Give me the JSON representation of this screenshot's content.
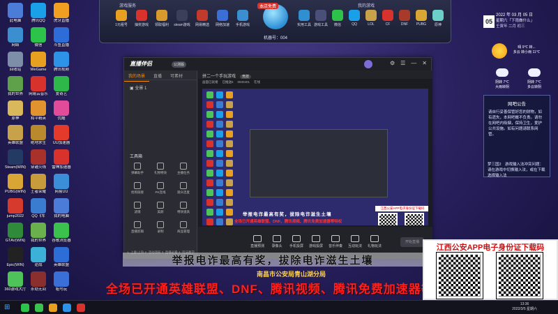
{
  "desktop": {
    "icons": [
      {
        "label": "此电脑",
        "color": "#4a7cd8"
      },
      {
        "label": "网络",
        "color": "#3b8fd0"
      },
      {
        "label": "回收站",
        "color": "#7d8fa8"
      },
      {
        "label": "我的世界",
        "color": "#5fa04a"
      },
      {
        "label": "原神",
        "color": "#d8b85a"
      },
      {
        "label": "英雄联盟",
        "color": "#c8a24a"
      },
      {
        "label": "Steam(WIN)",
        "color": "#233b63"
      },
      {
        "label": "PUBG(WIN)",
        "color": "#d9a534"
      },
      {
        "label": "jump2022",
        "color": "#d63a2c"
      },
      {
        "label": "GTAV(WIN)",
        "color": "#2f8a3a"
      },
      {
        "label": "Epic(WIN)",
        "color": "#222222"
      },
      {
        "label": "360游戏大厅",
        "color": "#4ec35a"
      },
      {
        "label": "腾讯QQ",
        "color": "#1aa0e8"
      },
      {
        "label": "微信",
        "color": "#2dc34a"
      },
      {
        "label": "WeGame",
        "color": "#e8a021"
      },
      {
        "label": "网易云音乐",
        "color": "#d8322c"
      },
      {
        "label": "和平精英",
        "color": "#e0932e"
      },
      {
        "label": "绝地求生",
        "color": "#b9892e"
      },
      {
        "label": "穿越火线",
        "color": "#a8312b"
      },
      {
        "label": "王者荣耀",
        "color": "#c79a3b"
      },
      {
        "label": "QQ飞车",
        "color": "#3a7dd0"
      },
      {
        "label": "我的世界",
        "color": "#6ab04c"
      },
      {
        "label": "逆战",
        "color": "#3bb1d8"
      },
      {
        "label": "永劫无间",
        "color": "#8a2e2e"
      },
      {
        "label": "虎牙直播",
        "color": "#f0a020"
      },
      {
        "label": "斗鱼直播",
        "color": "#2e6dd8"
      },
      {
        "label": "腾讯视频",
        "color": "#2c93e8"
      },
      {
        "label": "爱奇艺",
        "color": "#2fb84a"
      },
      {
        "label": "优酷",
        "color": "#e24b9a"
      },
      {
        "label": "UU加速器",
        "color": "#e43a2c"
      },
      {
        "label": "雷神加速器",
        "color": "#d8322c"
      },
      {
        "label": "网易UU",
        "color": "#3a8fd8"
      },
      {
        "label": "我的电脑",
        "color": "#4a7cd8"
      },
      {
        "label": "谷歌浏览器",
        "color": "#3ac14e"
      },
      {
        "label": "英雄联盟",
        "color": "#2c6dd8"
      },
      {
        "label": "租号玩",
        "color": "#3b6fd8"
      }
    ]
  },
  "topbar": {
    "left_section": "游戏服务",
    "right_section": "我的游戏",
    "center_tag": "本店免费",
    "machine_label": "机器号：004",
    "left_items": [
      "1元租号",
      "抽奖游戏",
      "领取福利",
      "steam游戏",
      "网易精选",
      "网络加速",
      "手机游戏"
    ],
    "right_items": [
      "实用工具",
      "游戏工具",
      "微信",
      "QQ",
      "LOL",
      "CF",
      "DNF",
      "PUBG",
      "原神"
    ]
  },
  "clock": {
    "day": "05",
    "date": "2022 年 03 月 05 日",
    "week": "星期六「下雨做什么」",
    "cal": "壬寅年 二月 初三"
  },
  "weather": {
    "today": "晴 9℃ 转...",
    "today_sub": "多云 转小雨 11℃",
    "tomorrow": "阴转 7℃",
    "tomorrow_sub": "大雨转阴",
    "day_after": "阴转 7℃",
    "day_after_sub": "多云转阴"
  },
  "notice": {
    "title": "网吧公告",
    "body": "请自行妥善保管好您的财物，如有遗失，本网吧概不负责。请勿在网吧内吸烟，保持卫生，爱护公共设施。如有问题请联系网管。",
    "body2": "梦三国2　游戏输入法冲突问题：请在游戏中切换输入法，或在下载选择输入法"
  },
  "app": {
    "title": "直播伴侣",
    "badge": "公测版",
    "tabs": [
      "我的场景",
      "直播",
      "可素材"
    ],
    "scene": "全景 1",
    "toolbox": "工具箱",
    "tools": [
      "弹幕助手",
      "礼物特效",
      "主播任务",
      "抢购链接",
      "PK连线",
      "观众连麦",
      "滤镜",
      "美颜",
      "特效道具",
      "直播剪辑",
      "录制",
      "商品管理"
    ],
    "main_head": "拼二一个手玩游戏",
    "scene_badge": "竞技",
    "status": [
      "画面已就绪",
      "已推送5",
      "0930401",
      "在线"
    ],
    "controls": [
      "直播预测",
      "录像头",
      "手机投屏",
      "游戏投屏",
      "音乐伴奏",
      "互动玩法",
      "礼物玩法"
    ],
    "go_live": "开始直播",
    "tips": "1. 上麦/上热   2. 活动须知   3. 直播必看   4. 玩法教学"
  },
  "preview": {
    "caption": "举报电诈最高有奖，拔除电诈滋生土壤",
    "red": "全场已开通英雄联盟、DNF、腾讯视频、腾讯免费加速器等特权",
    "qr_banner": "江西公安APP电子身份证下载码"
  },
  "banner": {
    "black": "举报电诈最高有奖，拔除电诈滋生土壤",
    "org": "南昌市公安局青山湖分局",
    "red": "全场已开通英雄联盟、DNF、腾讯视频、腾讯免费加速器等特权"
  },
  "qr_box": {
    "title": "江西公安APP电子身份证下载码"
  },
  "taskbar": {
    "time": "13:36",
    "date": "2022/3/5 星期六"
  }
}
